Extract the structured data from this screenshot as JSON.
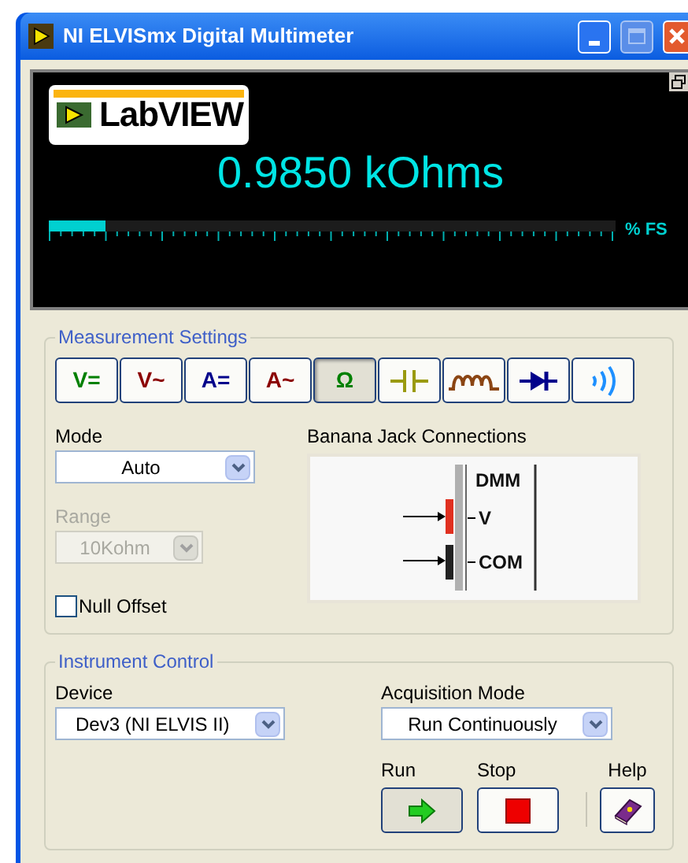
{
  "window": {
    "title": "NI ELVISmx Digital Multimeter"
  },
  "display": {
    "logo": "LabVIEW",
    "reading": "0.9850 kOhms",
    "bar": {
      "level": 0.1,
      "unit": "% FS"
    }
  },
  "measurement_settings": {
    "title": "Measurement Settings",
    "functions": [
      {
        "kind": "text",
        "label": "V=",
        "color": "#008000",
        "selected": false
      },
      {
        "kind": "text",
        "label": "V~",
        "color": "#8b0000",
        "selected": false
      },
      {
        "kind": "text",
        "label": "A=",
        "color": "#00008b",
        "selected": false
      },
      {
        "kind": "text",
        "label": "A~",
        "color": "#8b0000",
        "selected": false
      },
      {
        "kind": "text",
        "label": "Ω",
        "color": "#008000",
        "selected": true
      },
      {
        "kind": "capacitor",
        "color": "#9a9a10",
        "selected": false
      },
      {
        "kind": "inductor",
        "color": "#8b4513",
        "selected": false
      },
      {
        "kind": "diode",
        "color": "#00008b",
        "selected": false
      },
      {
        "kind": "continuity",
        "color": "#1e90ff",
        "selected": false
      }
    ],
    "mode": {
      "label": "Mode",
      "value": "Auto",
      "disabled": false
    },
    "range": {
      "label": "Range",
      "value": "10Kohm",
      "disabled": true
    },
    "null_offset": {
      "label": "Null Offset",
      "checked": false
    },
    "banana": {
      "label": "Banana Jack Connections",
      "dmm": "DMM",
      "v": "V",
      "com": "COM"
    }
  },
  "instrument_control": {
    "title": "Instrument Control",
    "device": {
      "label": "Device",
      "value": "Dev3 (NI ELVIS II)"
    },
    "acquisition_mode": {
      "label": "Acquisition Mode",
      "value": "Run Continuously"
    },
    "buttons": [
      {
        "kind": "run",
        "label": "Run"
      },
      {
        "kind": "stop",
        "label": "Stop"
      },
      {
        "kind": "help",
        "label": "Help"
      }
    ]
  }
}
